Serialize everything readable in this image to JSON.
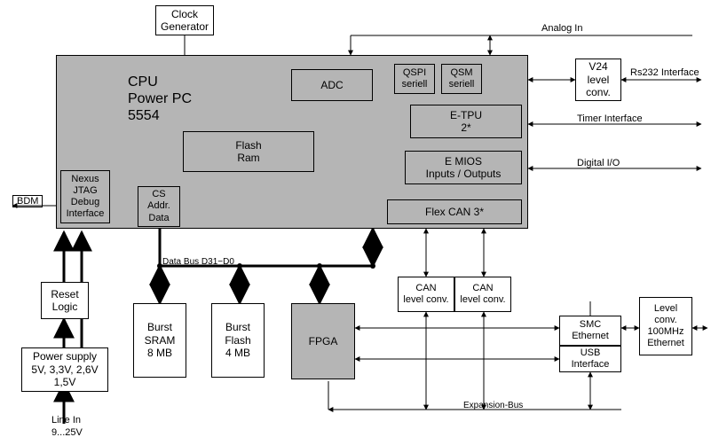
{
  "cpu": {
    "line1": "CPU",
    "line2": "Power PC",
    "line3": "5554"
  },
  "clock": {
    "line1": "Clock",
    "line2": "Generator"
  },
  "nexus": {
    "line1": "Nexus",
    "line2": "JTAG",
    "line3": "Debug",
    "line4": "Interface"
  },
  "csaddr": {
    "line1": "CS",
    "line2": "Addr.",
    "line3": "Data"
  },
  "flashram": {
    "line1": "Flash",
    "line2": "Ram"
  },
  "adc": {
    "line1": "ADC"
  },
  "qspi": {
    "line1": "QSPI",
    "line2": "seriell"
  },
  "qsm": {
    "line1": "QSM",
    "line2": "seriell"
  },
  "etpu": {
    "line1": "E-TPU",
    "line2": "2*"
  },
  "emios": {
    "line1": "E MIOS",
    "line2": "Inputs / Outputs"
  },
  "flexcan": {
    "line1": "Flex CAN 3*"
  },
  "v24": {
    "line1": "V24",
    "line2": "level",
    "line3": "conv."
  },
  "reset": {
    "line1": "Reset",
    "line2": "Logic"
  },
  "power": {
    "line1": "Power supply",
    "line2": "5V, 3,3V, 2,6V",
    "line3": "1,5V"
  },
  "sram": {
    "line1": "Burst",
    "line2": "SRAM",
    "line3": "8 MB"
  },
  "bflash": {
    "line1": "Burst",
    "line2": "Flash",
    "line3": "4 MB"
  },
  "fpga": {
    "line1": "FPGA"
  },
  "can1": {
    "line1": "CAN",
    "line2": "level conv."
  },
  "can2": {
    "line1": "CAN",
    "line2": "level conv."
  },
  "smc": {
    "line1": "SMC",
    "line2": "Ethernet"
  },
  "usb": {
    "line1": "USB",
    "line2": "Interface"
  },
  "lvlconv": {
    "line1": "Level",
    "line2": "conv.",
    "line3": "100MHz",
    "line4": "Ethernet"
  },
  "labels": {
    "analog_in": "Analog In",
    "rs232": "Rs232 Interface",
    "timer": "Timer Interface",
    "digital": "Digital I/O",
    "bdm": "BDM",
    "linein1": "Line In",
    "linein2": "9...25V",
    "databus": "Data Bus D31−D0",
    "expbus": "Expansion-Bus"
  }
}
